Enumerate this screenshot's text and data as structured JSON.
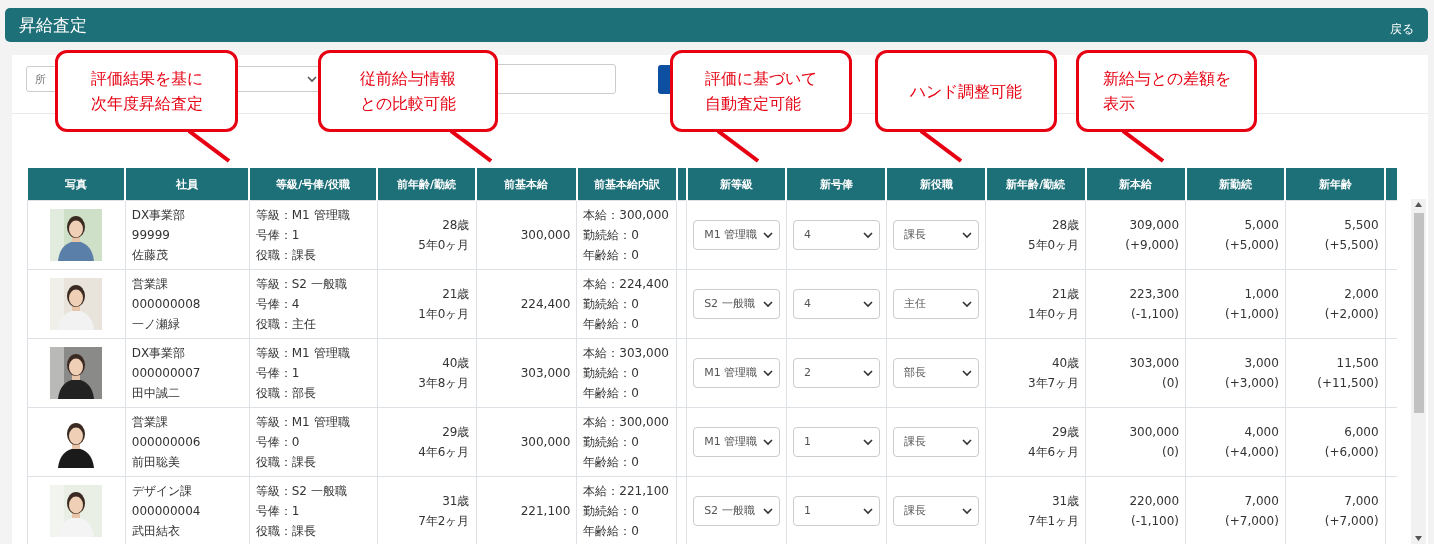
{
  "header": {
    "title": "昇給査定",
    "back_link": "戻る"
  },
  "filter": {
    "department_select": {
      "placeholder": "所"
    }
  },
  "callouts": [
    {
      "lines": [
        "評価結果を基に",
        "次年度昇給査定"
      ]
    },
    {
      "lines": [
        "従前給与情報",
        "との比較可能"
      ]
    },
    {
      "lines": [
        "評価に基づいて",
        "自動査定可能"
      ]
    },
    {
      "lines": [
        "ハンド調整可能"
      ]
    },
    {
      "lines": [
        "新給与との差額を",
        "表示"
      ]
    }
  ],
  "table": {
    "columns": [
      "写真",
      "社員",
      "等級/号俸/役職",
      "前年齢/勤続",
      "前基本給",
      "前基本給内訳",
      "",
      "新等級",
      "新号俸",
      "新役職",
      "新年齢/勤続",
      "新本給",
      "新勤続",
      "新年齢"
    ],
    "rows": [
      {
        "employee": [
          "DX事業部",
          "99999",
          "佐藤茂"
        ],
        "position": [
          "等級：M1 管理職",
          "号俸：1",
          "役職：課長"
        ],
        "prev_age": [
          "28歳",
          "5年0ヶ月"
        ],
        "prev_base": "300,000",
        "breakdown": [
          "本給：300,000",
          "勤続給：0",
          "年齢給：0"
        ],
        "new_grade": "M1 管理職",
        "new_step": "4",
        "new_post": "課長",
        "new_age": [
          "28歳",
          "5年0ヶ月"
        ],
        "new_base": [
          "309,000",
          "(+9,000)"
        ],
        "new_service": [
          "5,000",
          "(+5,000)"
        ],
        "new_age_pay": [
          "5,500",
          "(+5,500)"
        ]
      },
      {
        "employee": [
          "営業課",
          "000000008",
          "一ノ瀬緑"
        ],
        "position": [
          "等級：S2 一般職",
          "号俸：4",
          "役職：主任"
        ],
        "prev_age": [
          "21歳",
          "1年0ヶ月"
        ],
        "prev_base": "224,400",
        "breakdown": [
          "本給：224,400",
          "勤続給：0",
          "年齢給：0"
        ],
        "new_grade": "S2 一般職",
        "new_step": "4",
        "new_post": "主任",
        "new_age": [
          "21歳",
          "1年0ヶ月"
        ],
        "new_base": [
          "223,300",
          "(-1,100)"
        ],
        "new_service": [
          "1,000",
          "(+1,000)"
        ],
        "new_age_pay": [
          "2,000",
          "(+2,000)"
        ]
      },
      {
        "employee": [
          "DX事業部",
          "000000007",
          "田中誠二"
        ],
        "position": [
          "等級：M1 管理職",
          "号俸：1",
          "役職：部長"
        ],
        "prev_age": [
          "40歳",
          "3年8ヶ月"
        ],
        "prev_base": "303,000",
        "breakdown": [
          "本給：303,000",
          "勤続給：0",
          "年齢給：0"
        ],
        "new_grade": "M1 管理職",
        "new_step": "2",
        "new_post": "部長",
        "new_age": [
          "40歳",
          "3年7ヶ月"
        ],
        "new_base": [
          "303,000",
          "(0)"
        ],
        "new_service": [
          "3,000",
          "(+3,000)"
        ],
        "new_age_pay": [
          "11,500",
          "(+11,500)"
        ]
      },
      {
        "employee": [
          "営業課",
          "000000006",
          "前田聡美"
        ],
        "position": [
          "等級：M1 管理職",
          "号俸：0",
          "役職：課長"
        ],
        "prev_age": [
          "29歳",
          "4年6ヶ月"
        ],
        "prev_base": "300,000",
        "breakdown": [
          "本給：300,000",
          "勤続給：0",
          "年齢給：0"
        ],
        "new_grade": "M1 管理職",
        "new_step": "1",
        "new_post": "課長",
        "new_age": [
          "29歳",
          "4年6ヶ月"
        ],
        "new_base": [
          "300,000",
          "(0)"
        ],
        "new_service": [
          "4,000",
          "(+4,000)"
        ],
        "new_age_pay": [
          "6,000",
          "(+6,000)"
        ]
      },
      {
        "employee": [
          "デザイン課",
          "000000004",
          "武田結衣"
        ],
        "position": [
          "等級：S2 一般職",
          "号俸：1",
          "役職：課長"
        ],
        "prev_age": [
          "31歳",
          "7年2ヶ月"
        ],
        "prev_base": "221,100",
        "breakdown": [
          "本給：221,100",
          "勤続給：0",
          "年齢給：0"
        ],
        "new_grade": "S2 一般職",
        "new_step": "1",
        "new_post": "課長",
        "new_age": [
          "31歳",
          "7年1ヶ月"
        ],
        "new_base": [
          "220,000",
          "(-1,100)"
        ],
        "new_service": [
          "7,000",
          "(+7,000)"
        ],
        "new_age_pay": [
          "7,000",
          "(+7,000)"
        ]
      }
    ]
  }
}
